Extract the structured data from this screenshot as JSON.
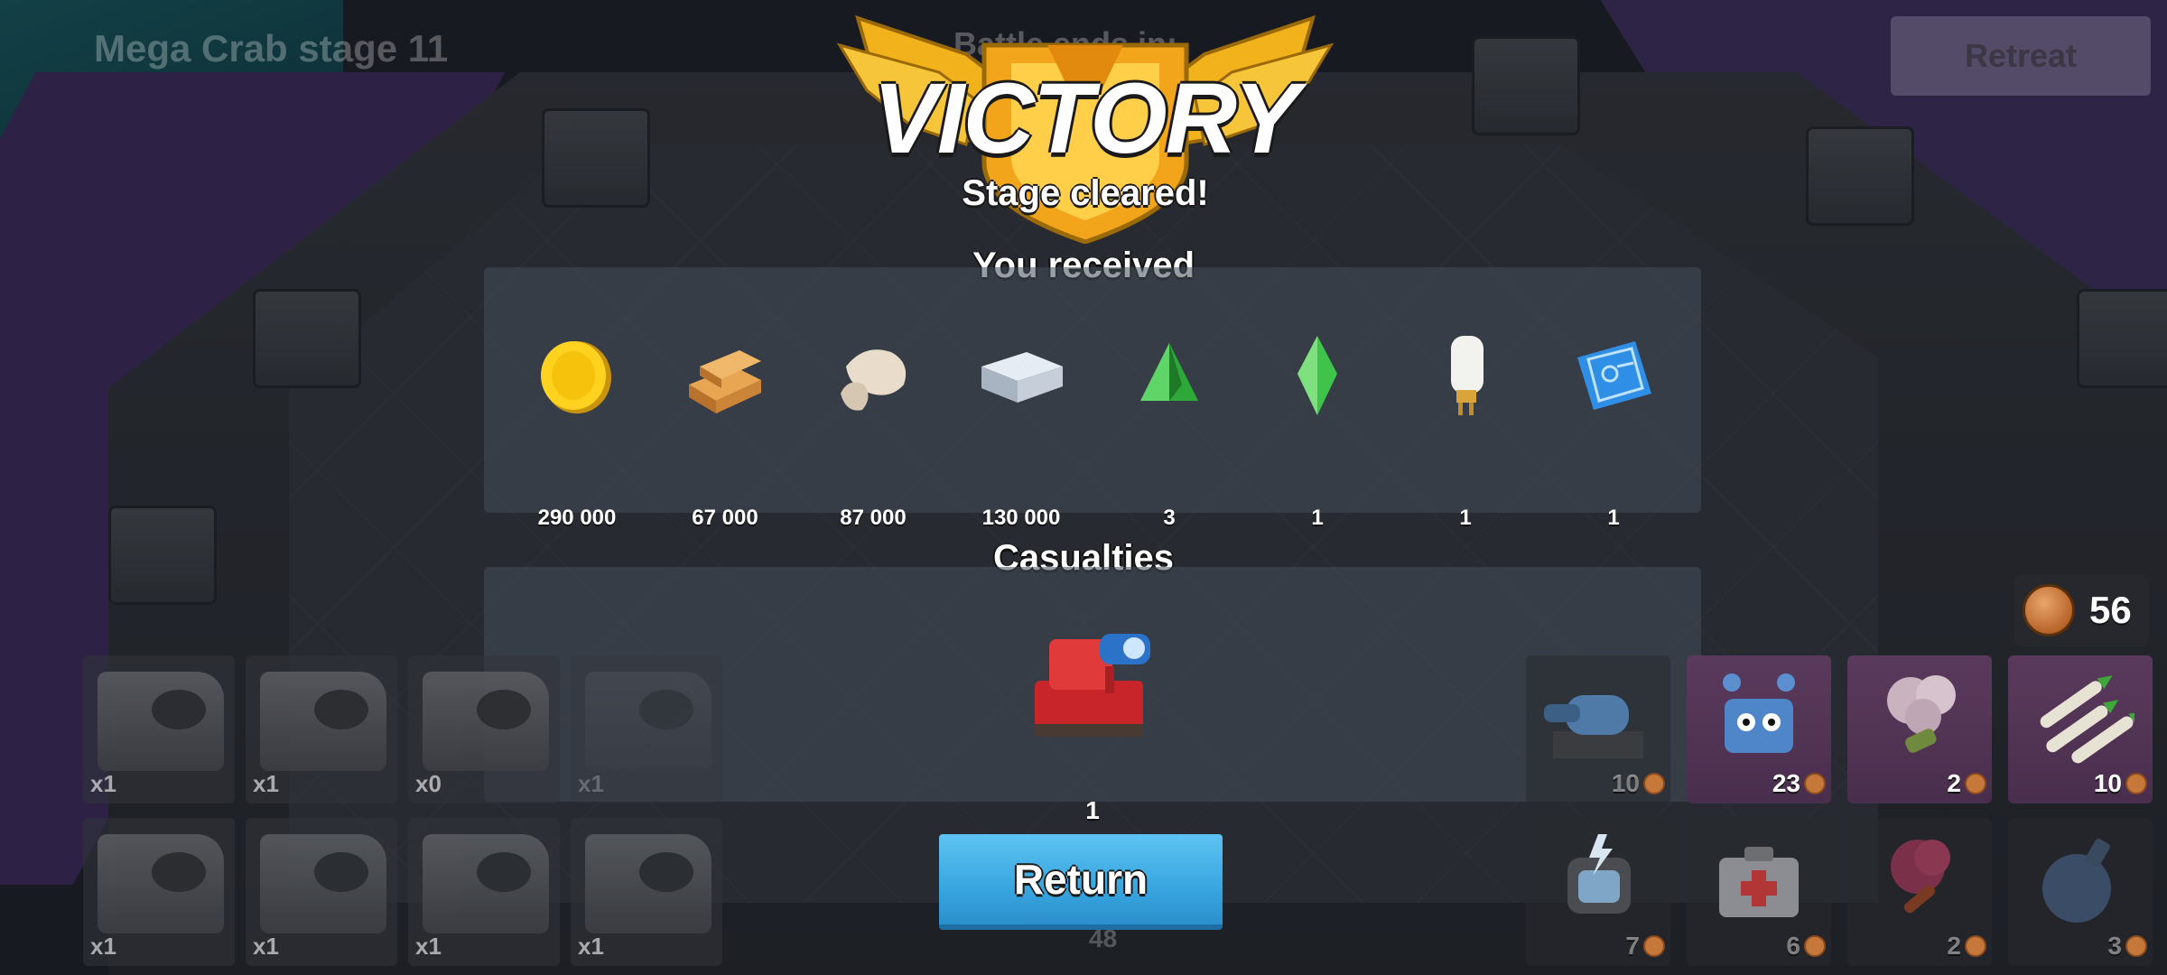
{
  "hud": {
    "stage_title": "Mega Crab stage 11",
    "battle_ends_label": "Battle ends in:",
    "retreat_label": "Retreat",
    "energy": "56"
  },
  "banner": {
    "title": "VICTORY",
    "subtitle": "Stage cleared!"
  },
  "rewards": {
    "heading": "You received",
    "items": [
      {
        "icon": "gold-coin-icon",
        "value": "290 000"
      },
      {
        "icon": "wood-icon",
        "value": "67 000"
      },
      {
        "icon": "stone-icon",
        "value": "87 000"
      },
      {
        "icon": "iron-icon",
        "value": "130 000"
      },
      {
        "icon": "power-crystal-icon",
        "value": "3"
      },
      {
        "icon": "ice-crystal-icon",
        "value": "1"
      },
      {
        "icon": "power-powder-icon",
        "value": "1"
      },
      {
        "icon": "blueprint-icon",
        "value": "1"
      }
    ]
  },
  "casualties": {
    "heading": "Casualties",
    "items": [
      {
        "icon": "tank-unit-icon",
        "value": "1"
      }
    ]
  },
  "return_label": "Return",
  "troops": {
    "row1": [
      "x1",
      "x1",
      "x0",
      "x1"
    ],
    "row2": [
      "x1",
      "x1",
      "x1",
      "x1"
    ]
  },
  "abilities": {
    "row1": [
      {
        "icon": "artillery-icon",
        "count": "10"
      },
      {
        "icon": "critters-icon",
        "count": "23"
      },
      {
        "icon": "smoke-bomb-icon",
        "count": "2"
      },
      {
        "icon": "barrage-icon",
        "count": "10"
      }
    ],
    "row2": [
      {
        "icon": "shock-bomb-icon",
        "count": "7"
      },
      {
        "icon": "medkit-icon",
        "count": "6"
      },
      {
        "icon": "flare-icon",
        "count": "2"
      },
      {
        "icon": "bomb-icon",
        "count": "3"
      }
    ]
  },
  "faded_counter": "48",
  "colors": {
    "return_button": "#38a6e0",
    "banner_gold": "#f2b21b",
    "panel": "#464c5a"
  }
}
